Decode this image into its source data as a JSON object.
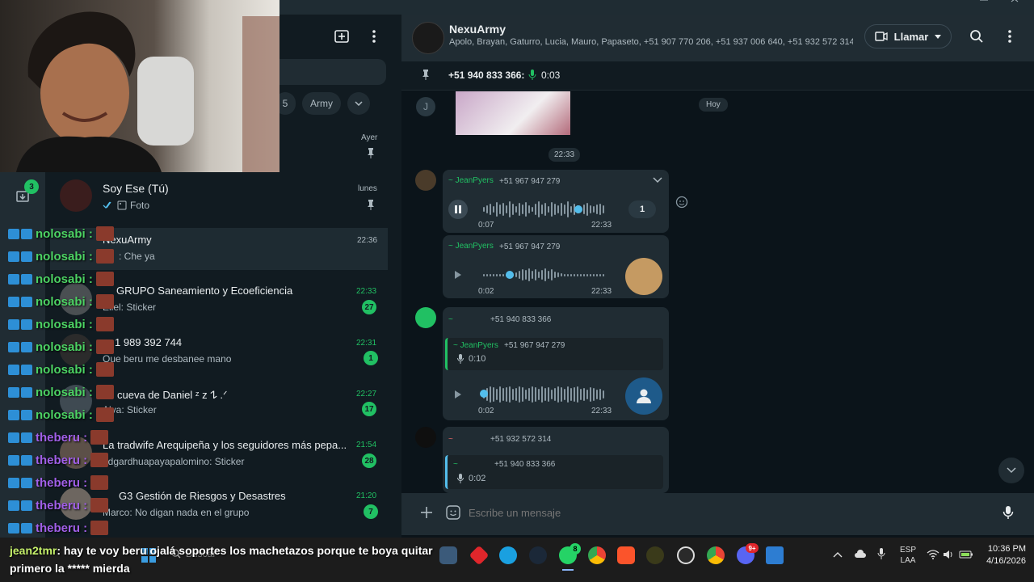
{
  "left": {
    "filter_chips": [
      "5",
      "Army"
    ],
    "pinned_time": "Ayer",
    "archived_count": "3",
    "self_chat": {
      "name": "Soy Ese (Tú)",
      "preview": "Foto",
      "time": "lunes"
    },
    "chats": [
      {
        "name": "NexuArmy",
        "preview": ": Che ya",
        "time": "22:36",
        "unread": ""
      },
      {
        "name": "GRUPO Saneamiento y Ecoeficiencia",
        "preview": "Eliel: Sticker",
        "time": "22:33",
        "unread": "27"
      },
      {
        "name": "1 989 392 744",
        "preview": "Que beru me desbanee mano",
        "time": "22:31",
        "unread": "1"
      },
      {
        "name": "cueva de Daniel ᶻ z 𐰁 .ᐟ",
        "preview": "Alva: Sticker",
        "time": "22:27",
        "unread": "17"
      },
      {
        "name": "La tradwife Arequipeña y los seguidores más pepa...",
        "preview": "edgardhuapayapalomino: Sticker",
        "time": "21:54",
        "unread": "28"
      },
      {
        "name": "G3 Gestión de Riesgos y Desastres",
        "preview": "Marco: No digan nada en el grupo",
        "time": "21:20",
        "unread": "7"
      }
    ]
  },
  "stream_chat": {
    "lines": [
      {
        "user": "nolosabi :",
        "color": "green"
      },
      {
        "user": "nolosabi :",
        "color": "green"
      },
      {
        "user": "nolosabi :",
        "color": "green"
      },
      {
        "user": "nolosabi :",
        "color": "green"
      },
      {
        "user": "nolosabi :",
        "color": "green"
      },
      {
        "user": "nolosabi :",
        "color": "green"
      },
      {
        "user": "nolosabi :",
        "color": "green"
      },
      {
        "user": "nolosabi :",
        "color": "green"
      },
      {
        "user": "nolosabi :",
        "color": "green"
      },
      {
        "user": "theberu :",
        "color": "purple"
      },
      {
        "user": "theberu :",
        "color": "purple"
      },
      {
        "user": "theberu :",
        "color": "purple"
      },
      {
        "user": "theberu :",
        "color": "purple"
      },
      {
        "user": "theberu :",
        "color": "purple"
      }
    ],
    "last_message_user": "jean2tmr",
    "last_message_text": ": hay te voy beru ojalá soportes los machetazos porque te boya quitar primero la ***** mierda"
  },
  "header": {
    "group_name": "NexuArmy",
    "members": "Apolo, Brayan, Gaturro, Lucia, Mauro, Papaseto, +51 907 770 206, +51 937 006 640, +51 932 572 314,...",
    "call_label": "Llamar"
  },
  "pinned": {
    "sender": "+51 940 833 366:",
    "duration": "0:03"
  },
  "messages": {
    "avatar_letter": "J",
    "day_label": "Hoy",
    "time_label": "22:33",
    "voice1": {
      "sender": "~ JeanPyers",
      "phone": "+51 967 947 279",
      "elapsed": "0:07",
      "time": "22:33",
      "speed": "1"
    },
    "voice2": {
      "sender": "~ JeanPyers",
      "phone": "+51 967 947 279",
      "elapsed": "0:02",
      "time": "22:33"
    },
    "voice3": {
      "sender": "~",
      "phone": "+51 940 833 366",
      "quoted_sender": "~ JeanPyers",
      "quoted_phone": "+51 967 947 279",
      "quoted_duration": "0:10",
      "elapsed": "0:02",
      "time": "22:33"
    },
    "voice4": {
      "sender": "~",
      "phone": "+51 932 572 314",
      "quoted_sender": "~",
      "quoted_phone": "+51 940 833 366",
      "quoted_duration": "0:02"
    }
  },
  "composer": {
    "placeholder": "Escribe un mensaje"
  },
  "taskbar": {
    "search_placeholder": "Buscar",
    "lang1": "ESP",
    "lang2": "LAA",
    "time": "10:36 PM",
    "date": "4/16/2026",
    "whatsapp_badge": "8",
    "discord_badge": "9+"
  },
  "colors": {
    "accent": "#21c063",
    "panel": "#202c33",
    "background": "#0b141a"
  }
}
